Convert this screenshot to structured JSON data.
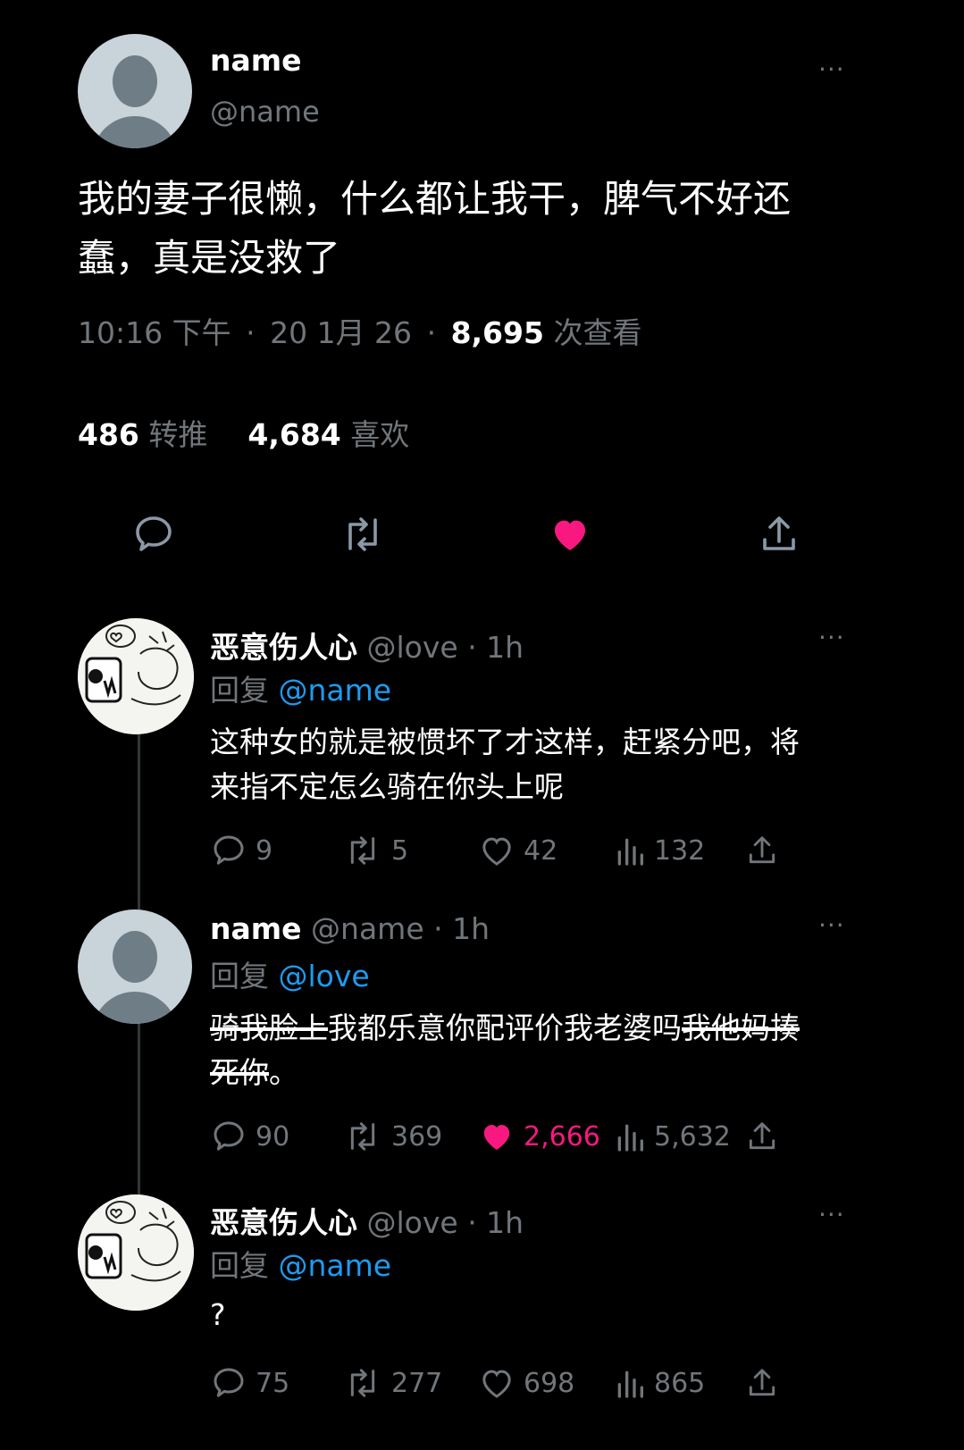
{
  "main_tweet": {
    "display_name": "name",
    "handle": "@name",
    "text_line1": "我的妻子很懒，什么都让我干，脾气不好还",
    "text_line2": "蠢，真是没救了",
    "time": "10:16 下午",
    "date": "20 1月 26",
    "sep": "·",
    "views_count": "8,695",
    "views_label": "次查看",
    "retweets_count": "486",
    "retweets_label": "转推",
    "likes_count": "4,684",
    "likes_label": "喜欢",
    "more": "···"
  },
  "replies": [
    {
      "display_name": "恶意伤人心",
      "handle": "@love",
      "time": "· 1h",
      "reply_prefix": "回复",
      "reply_to": "@name",
      "text_line1": "这种女的就是被惯坏了才这样，赶紧分吧，将",
      "text_line2": "来指不定怎么骑在你头上呢",
      "comments": "9",
      "retweets": "5",
      "likes": "42",
      "views": "132",
      "liked": false,
      "more": "···"
    },
    {
      "display_name": "name",
      "handle": "@name",
      "time": "· 1h",
      "reply_prefix": "回复",
      "reply_to": "@love",
      "struck_start": "骑我脸上",
      "text_middle": "我都乐意你配评价我老婆吗",
      "struck_end": "我他妈揍",
      "struck_line2": "死你",
      "text_end": "。",
      "comments": "90",
      "retweets": "369",
      "likes": "2,666",
      "views": "5,632",
      "liked": true,
      "more": "···"
    },
    {
      "display_name": "恶意伤人心",
      "handle": "@love",
      "time": "· 1h",
      "reply_prefix": "回复",
      "reply_to": "@name",
      "text_line1": "?",
      "comments": "75",
      "retweets": "277",
      "likes": "698",
      "views": "865",
      "liked": false,
      "more": "···"
    }
  ],
  "colors": {
    "like_red": "#f91880",
    "link_blue": "#1d9bf0",
    "muted": "#71767b"
  },
  "icons": [
    "comment-icon",
    "retweet-icon",
    "heart-icon",
    "share-icon",
    "views-icon",
    "more-icon"
  ]
}
